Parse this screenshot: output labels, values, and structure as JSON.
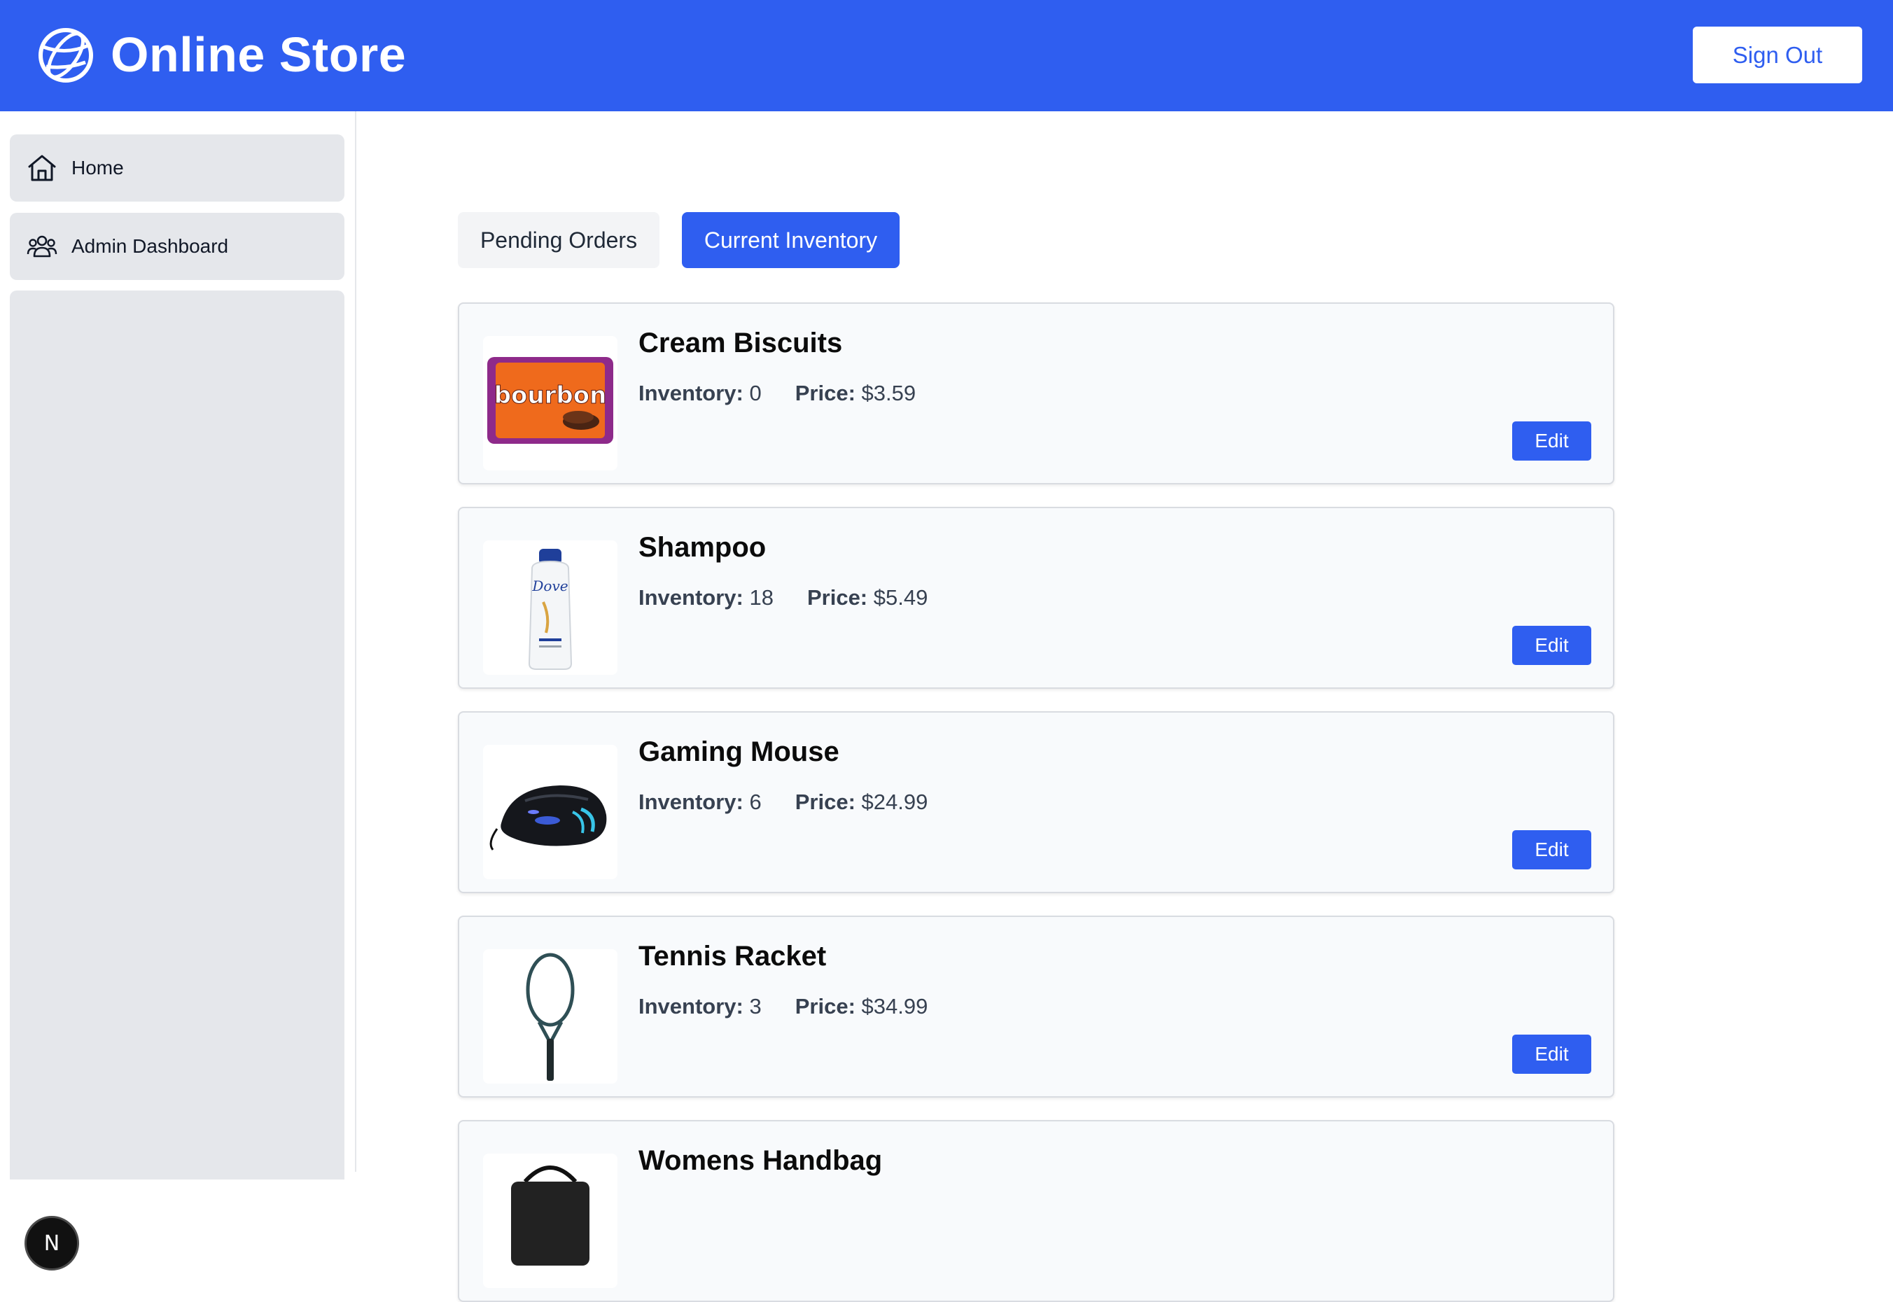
{
  "app": {
    "title": "Online Store",
    "sign_out_label": "Sign Out",
    "brand_icon": "globe-icon",
    "accent_color": "#2f5ef0"
  },
  "sidebar": {
    "items": [
      {
        "label": "Home",
        "icon": "home-icon"
      },
      {
        "label": "Admin Dashboard",
        "icon": "users-icon"
      }
    ],
    "dev_badge": "N"
  },
  "tabs": [
    {
      "label": "Pending Orders",
      "active": false
    },
    {
      "label": "Current Inventory",
      "active": true
    }
  ],
  "products": [
    {
      "name": "Cream Biscuits",
      "inventory_label": "Inventory:",
      "inventory": "0",
      "price_label": "Price:",
      "price": "$3.59",
      "edit_label": "Edit",
      "image_text": "bourbon"
    },
    {
      "name": "Shampoo",
      "inventory_label": "Inventory:",
      "inventory": "18",
      "price_label": "Price:",
      "price": "$5.49",
      "edit_label": "Edit",
      "image_text": "Dove"
    },
    {
      "name": "Gaming Mouse",
      "inventory_label": "Inventory:",
      "inventory": "6",
      "price_label": "Price:",
      "price": "$24.99",
      "edit_label": "Edit"
    },
    {
      "name": "Tennis Racket",
      "inventory_label": "Inventory:",
      "inventory": "3",
      "price_label": "Price:",
      "price": "$34.99",
      "edit_label": "Edit"
    },
    {
      "name": "Womens Handbag"
    }
  ]
}
